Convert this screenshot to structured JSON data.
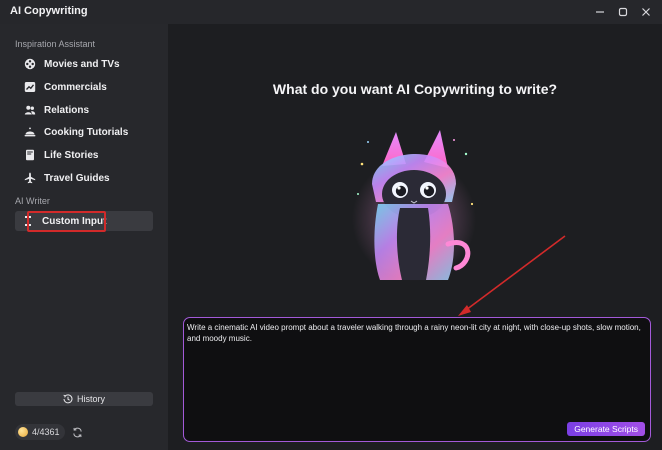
{
  "window": {
    "title": "AI Copywriting"
  },
  "sidebar": {
    "inspiration_label": "Inspiration Assistant",
    "inspiration_items": [
      {
        "label": "Movies and TVs",
        "icon": "film-reel-icon"
      },
      {
        "label": "Commercials",
        "icon": "chart-icon"
      },
      {
        "label": "Relations",
        "icon": "people-icon"
      },
      {
        "label": "Cooking Tutorials",
        "icon": "cloche-icon"
      },
      {
        "label": "Life Stories",
        "icon": "book-icon"
      },
      {
        "label": "Travel Guides",
        "icon": "airplane-icon"
      }
    ],
    "writer_label": "AI Writer",
    "writer_items": [
      {
        "label": "Custom Input",
        "icon": "custom-input-icon",
        "active": true
      }
    ],
    "history_label": "History",
    "credits": "4/4361"
  },
  "main": {
    "heading": "What do you want AI Copywriting to write?",
    "prompt_value": "Write a cinematic AI video prompt about a traveler walking through a rainy neon-lit city at night, with close-up shots, slow motion, and moody music.",
    "generate_label": "Generate Scripts"
  },
  "colors": {
    "accent_purple": "#a35ad9",
    "annotation_red": "#d22a2a",
    "sidebar_bg": "#27282c",
    "main_bg": "#1d1e21"
  }
}
